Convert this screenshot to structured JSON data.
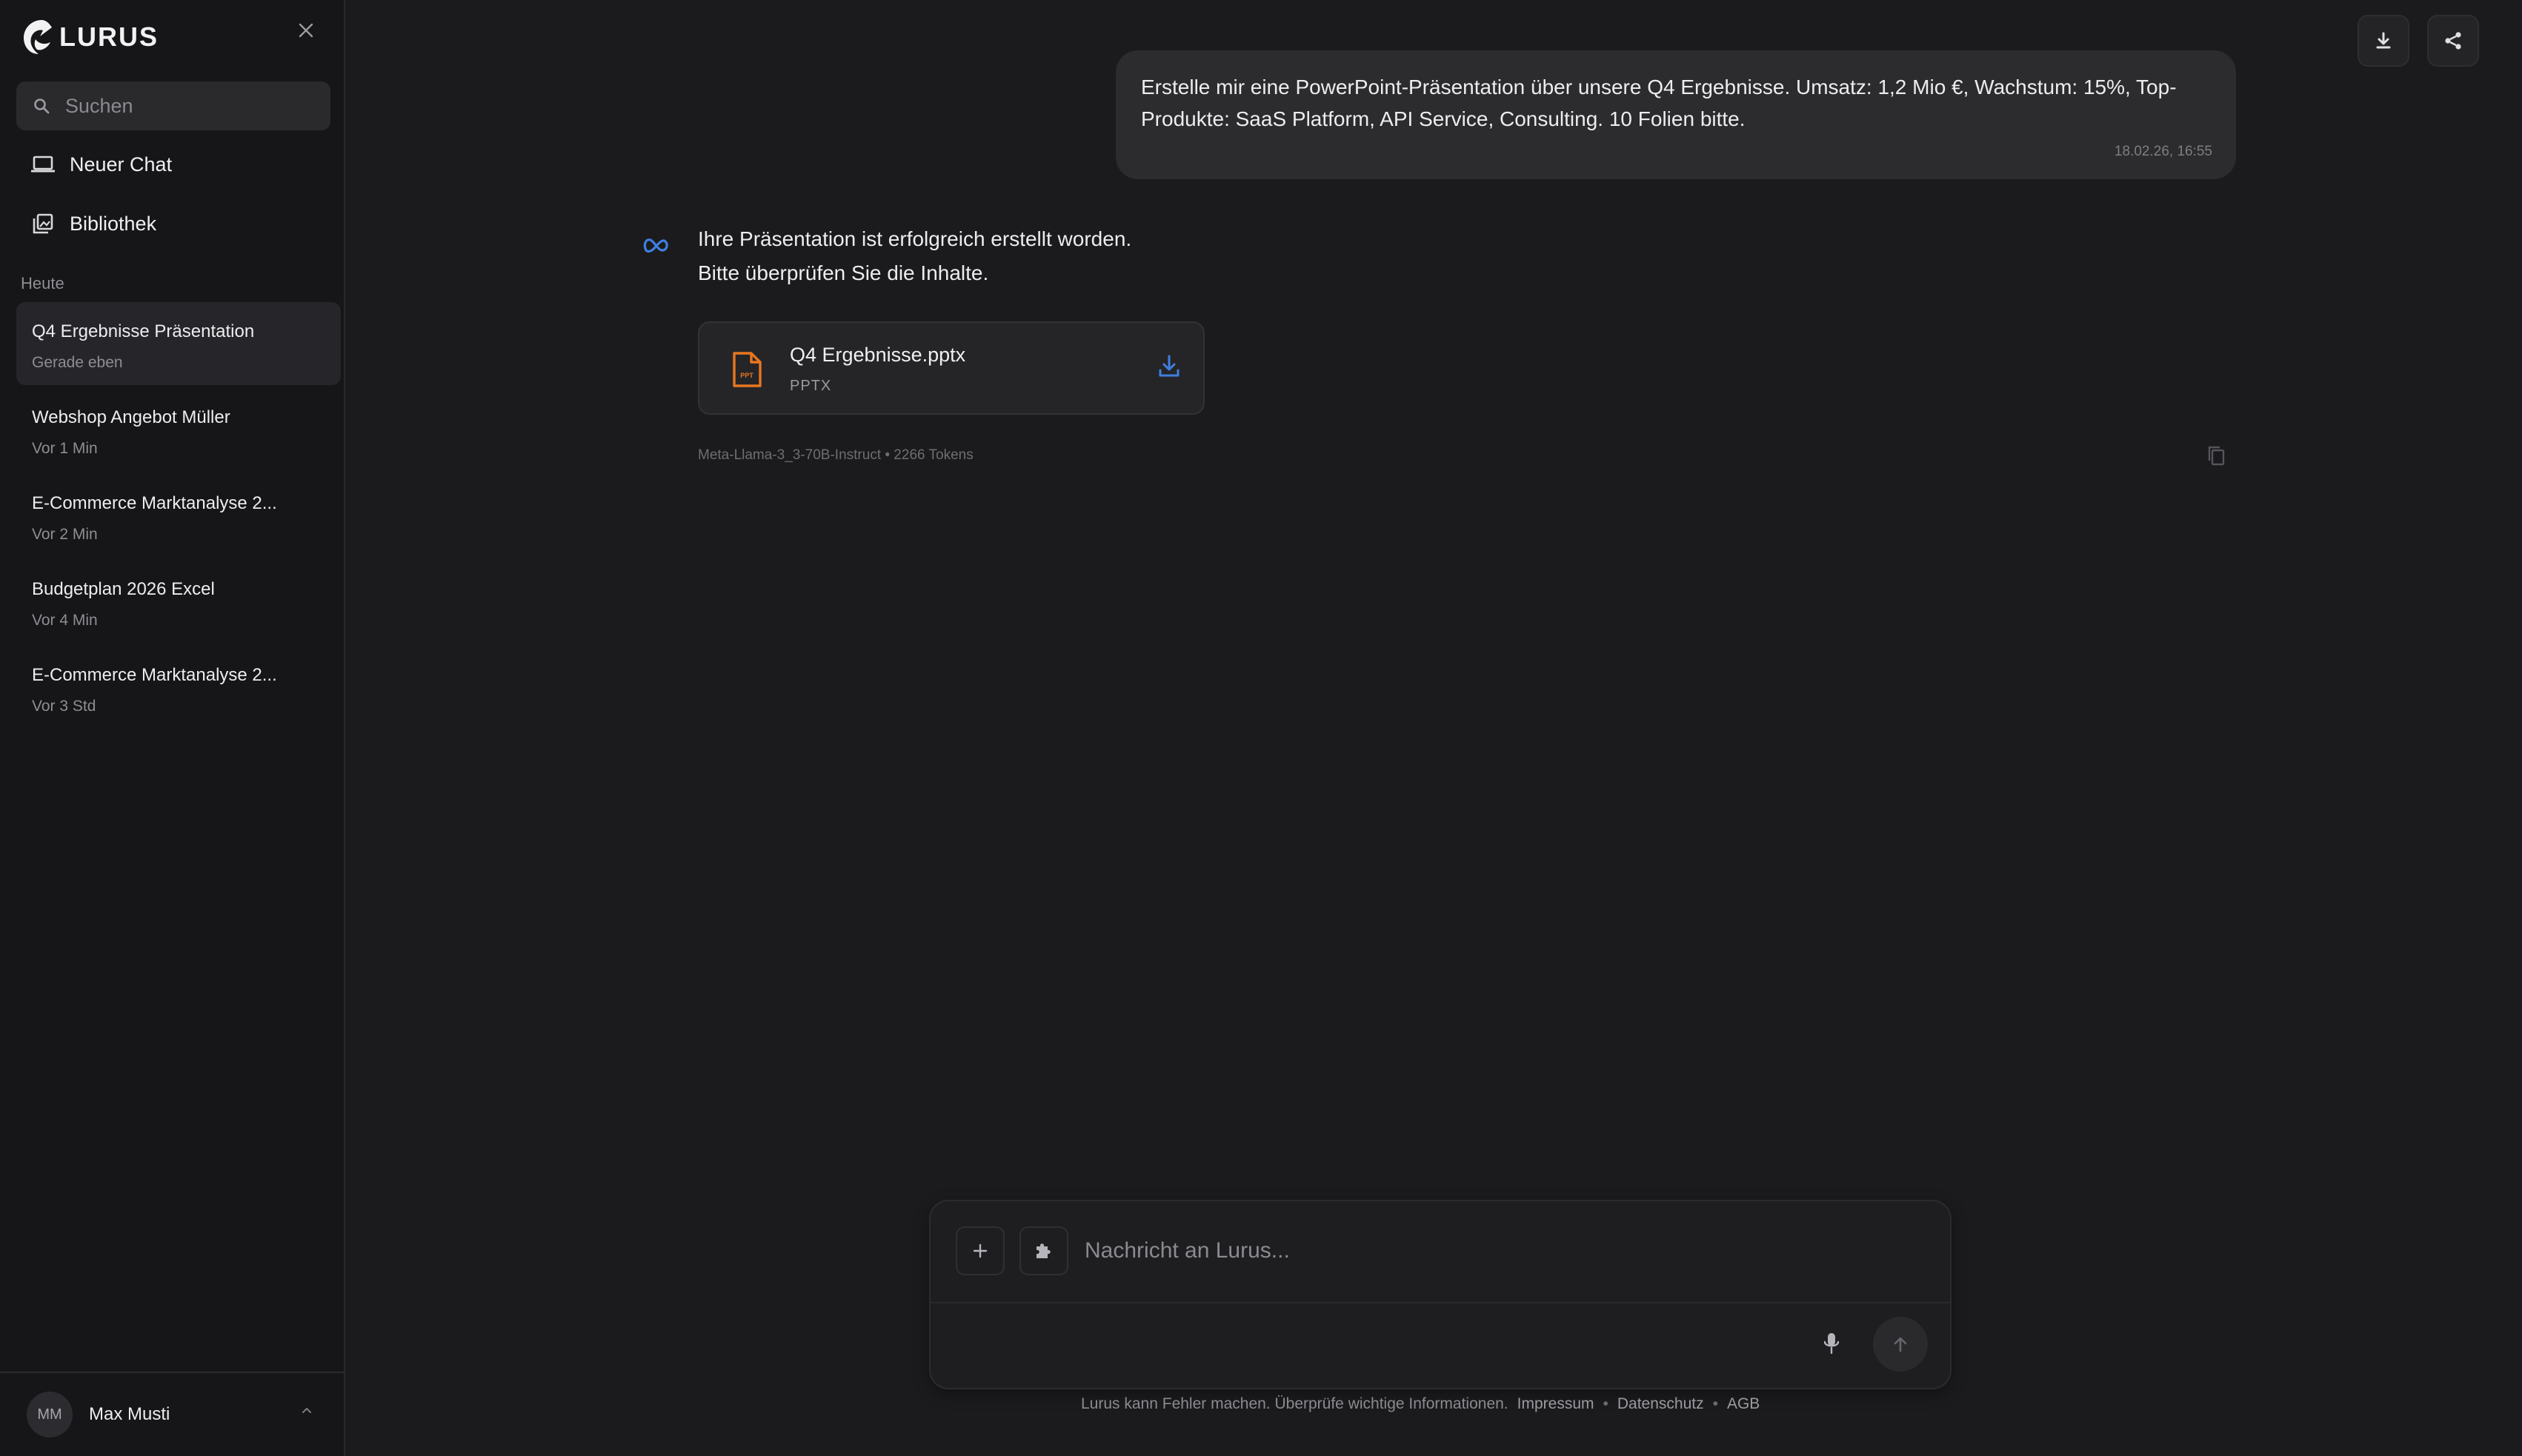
{
  "brand": {
    "name": "LURUS",
    "accent": "#e8761f",
    "link_blue": "#3f7fe0"
  },
  "sidebar": {
    "search": {
      "placeholder": "Suchen",
      "icon": "search-icon"
    },
    "nav": [
      {
        "label": "Neuer Chat",
        "icon": "laptop-icon"
      },
      {
        "label": "Bibliothek",
        "icon": "library-icon"
      }
    ],
    "section_label": "Heute",
    "conversations": [
      {
        "title": "Q4 Ergebnisse Präsentation",
        "time": "Gerade eben",
        "active": true
      },
      {
        "title": "Webshop Angebot Müller",
        "time": "Vor 1 Min"
      },
      {
        "title": "E-Commerce Marktanalyse 2...",
        "time": "Vor 2 Min"
      },
      {
        "title": "Budgetplan 2026 Excel",
        "time": "Vor 4 Min"
      },
      {
        "title": "E-Commerce Marktanalyse 2...",
        "time": "Vor 3 Std"
      }
    ],
    "user": {
      "initials": "MM",
      "name": "Max Musti"
    }
  },
  "chat": {
    "user_message": {
      "text": "Erstelle mir eine PowerPoint-Präsentation über unsere Q4 Ergebnisse. Umsatz: 1,2 Mio €, Wachstum: 15%, Top-Produkte: SaaS Platform, API Service, Consulting. 10 Folien bitte.",
      "timestamp": "18.02.26, 16:55"
    },
    "bot_message": {
      "line1": "Ihre Präsentation ist erfolgreich erstellt worden.",
      "line2": "Bitte überprüfen Sie die Inhalte.",
      "file": {
        "name": "Q4 Ergebnisse.pptx",
        "type": "PPTX",
        "icon_label": "PPT"
      },
      "meta": "Meta-Llama-3_3-70B-Instruct • 2266 Tokens"
    }
  },
  "composer": {
    "placeholder": "Nachricht an Lurus..."
  },
  "footer": {
    "disclaimer": "Lurus kann Fehler machen. Überprüfe wichtige Informationen.",
    "links": [
      "Impressum",
      "Datenschutz",
      "AGB"
    ],
    "separator": "•"
  }
}
